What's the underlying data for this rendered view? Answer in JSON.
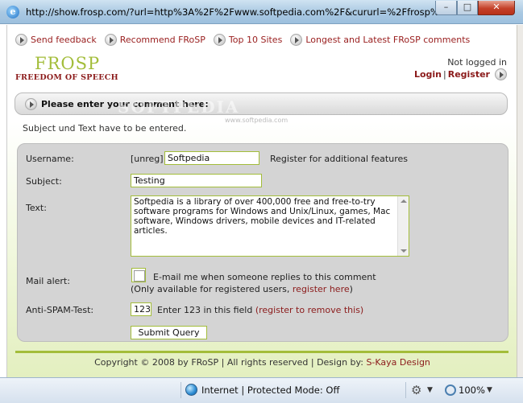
{
  "window": {
    "title": "http://show.frosp.com/?url=http%3A%2F%2Fwww.softpedia.com%2F&cururl=%2Ffrosp%2Fsh...",
    "minimize": "–",
    "maximize": "□",
    "close": "✕"
  },
  "topnav": [
    {
      "label": "Send feedback"
    },
    {
      "label": "Recommend FRoSP"
    },
    {
      "label": "Top 10 Sites"
    },
    {
      "label": "Longest and Latest FRoSP comments"
    }
  ],
  "logo": {
    "line1": "FROSP",
    "line2": "FREEDOM OF SPEECH"
  },
  "login": {
    "status": "Not logged in",
    "login": "Login",
    "separator": "|",
    "register": "Register"
  },
  "banner": {
    "text": "Please enter your comment here:"
  },
  "watermark": {
    "text": "SOFTPEDIA",
    "url": "www.softpedia.com"
  },
  "notice": "Subject und Text have to be entered.",
  "form": {
    "username_label": "Username:",
    "username_prefix": "[unreg]",
    "username_value": "Softpedia",
    "register_link": "Register for additional features",
    "subject_label": "Subject:",
    "subject_value": "Testing",
    "text_label": "Text:",
    "text_value": "Softpedia is a library of over 400,000 free and free-to-try software programs for Windows and Unix/Linux, games, Mac software, Windows drivers, mobile devices and IT-related articles.",
    "mail_label": "Mail alert:",
    "mail_text": "E-mail me when someone replies to this comment",
    "mail_note_prefix": "(Only available for registered users, ",
    "mail_note_link": "register here",
    "mail_note_suffix": ")",
    "antispam_label": "Anti-SPAM-Test:",
    "antispam_value": "123",
    "antispam_hint": "Enter 123 in this field",
    "antispam_link": "(register to remove this)",
    "submit": "Submit Query"
  },
  "footer": {
    "text": "Copyright © 2008 by FRoSP | All rights reserved | Design by: ",
    "design_link": "S-Kaya Design"
  },
  "statusbar": {
    "zone": "Internet | Protected Mode: Off",
    "zoom": "100%"
  }
}
